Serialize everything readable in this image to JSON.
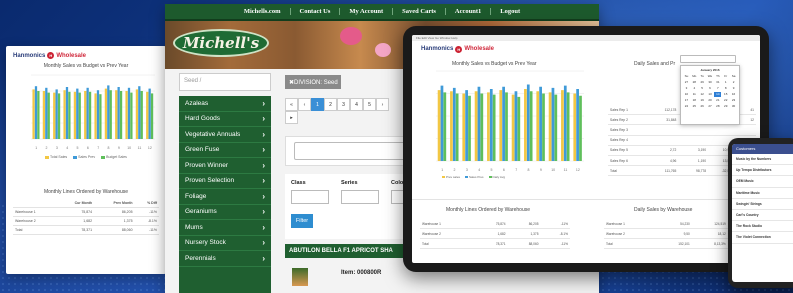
{
  "left_card": {
    "logo": {
      "name": "Hanmonics",
      "badge": "H",
      "suffix": "Wholesale"
    },
    "chart": {
      "title": "Monthly Sales vs Budget vs Prev Year"
    },
    "chart_data": {
      "type": "bar",
      "categories": [
        "1",
        "2",
        "3",
        "4",
        "5",
        "6",
        "7",
        "8",
        "9",
        "10",
        "11",
        "12"
      ],
      "series": [
        {
          "name": "Total Sales",
          "values": [
            62,
            60,
            58,
            61,
            59,
            60,
            57,
            63,
            61,
            60,
            62,
            59
          ],
          "color": "#f2c744"
        },
        {
          "name": "Sales Prev",
          "values": [
            66,
            64,
            62,
            65,
            63,
            64,
            61,
            67,
            65,
            64,
            66,
            63
          ],
          "color": "#3f9ad8"
        },
        {
          "name": "Budget Sales",
          "values": [
            60,
            58,
            57,
            59,
            58,
            59,
            56,
            61,
            60,
            58,
            60,
            57
          ],
          "color": "#5fbf5b"
        }
      ],
      "ylim": [
        0,
        80
      ]
    },
    "lines_title": "Monthly Lines Ordered by Warehouse",
    "lines_headers": [
      "",
      "Cur Month",
      "Prev Month",
      "% Diff"
    ],
    "lines_rows": [
      [
        "Warehouse 1",
        "75,874",
        "86,205",
        "-11%"
      ],
      [
        "Warehouse 2",
        "1,682",
        "1,375",
        "-8.1%"
      ],
      [
        "Total",
        "78,371",
        "88,060",
        "-11%"
      ]
    ]
  },
  "shop": {
    "nav": [
      "Michells.com",
      "Contact Us",
      "My Account",
      "Saved Carts",
      "Account1",
      "Logout"
    ],
    "brand": "Michell's",
    "search_placeholder": "Seed /",
    "division": "✖DIVISION: Seed",
    "sidebar": [
      "Azaleas",
      "Hard Goods",
      "Vegetative Annuals",
      "Green Fuse",
      "Proven Winner",
      "Proven Selection",
      "Foliage",
      "Geraniums",
      "Mums",
      "Nursery Stock",
      "Perennials"
    ],
    "pager": [
      "«",
      "‹",
      "1",
      "2",
      "3",
      "4",
      "5",
      "›",
      "▸"
    ],
    "filter_labels": [
      "Class",
      "Series",
      "Colo"
    ],
    "filter_button": "Filter",
    "product_title": "ABUTILON BELLA F1 APRICOT SHA",
    "item_label": "Item: 000800R"
  },
  "tablet": {
    "menu": "File  Edit  View  Go  Window  Help",
    "logo": {
      "name": "Hanmonics",
      "badge": "H",
      "suffix": "Wholesale"
    },
    "chart_title": "Monthly Sales vs Budget vs Prev Year",
    "chart_title_right": "Daily Sales and Pr",
    "chart_data": {
      "type": "bar",
      "categories": [
        "1",
        "2",
        "3",
        "4",
        "5",
        "6",
        "7",
        "8",
        "9",
        "10",
        "11",
        "12"
      ],
      "series": [
        {
          "name": "Prev sales",
          "values": [
            63,
            62,
            60,
            62,
            61,
            63,
            59,
            64,
            62,
            61,
            63,
            60
          ],
          "color": "#f2c744"
        },
        {
          "name": "Sales Pres",
          "values": [
            67,
            65,
            63,
            66,
            64,
            66,
            62,
            68,
            66,
            65,
            67,
            64
          ],
          "color": "#3f9ad8"
        },
        {
          "name": "Daily Avg",
          "values": [
            61,
            60,
            58,
            60,
            59,
            61,
            57,
            62,
            60,
            59,
            61,
            58
          ],
          "color": "#5fbf5b"
        }
      ],
      "ylim": [
        0,
        80
      ]
    },
    "calendar_title": "January 2016",
    "calendar_dow": [
      "Su",
      "Mo",
      "Tu",
      "We",
      "Th",
      "Fr",
      "Sa"
    ],
    "calendar_days": [
      "27",
      "28",
      "29",
      "30",
      "31",
      "1",
      "2",
      "3",
      "4",
      "5",
      "6",
      "7",
      "8",
      "9",
      "10",
      "11",
      "12",
      "13",
      "14",
      "15",
      "16",
      "17",
      "18",
      "19",
      "20",
      "21",
      "22",
      "23",
      "24",
      "25",
      "26",
      "27",
      "28",
      "29",
      "30"
    ],
    "calendar_selected": "14",
    "rep_rows": [
      [
        "Sales Rep 1",
        "112,178",
        "108,210",
        "93,4",
        "41"
      ],
      [
        "Sales Rep 2",
        "31,848",
        "22,320",
        "2,9",
        "12"
      ],
      [
        "Sales Rep 3",
        "",
        "",
        "",
        ""
      ],
      [
        "Sales Rep 4",
        "",
        "",
        "",
        ""
      ],
      [
        "Sales Rep 5",
        "2,72",
        "3,190",
        "10,90",
        "30"
      ],
      [
        "Sales Rep 6",
        "4,96",
        "1,190",
        "13,56",
        "2,3"
      ],
      [
        "Total",
        "111,765",
        "98,778",
        "-32,57",
        "82,90"
      ]
    ],
    "lines_title": "Monthly Lines Ordered by Warehouse",
    "lines_rows": [
      [
        "Warehouse 1",
        "75,874",
        "86,205",
        "-11%"
      ],
      [
        "Warehouse 2",
        "1,682",
        "1,375",
        "-8.1%"
      ],
      [
        "Total",
        "78,371",
        "88,060",
        "-11%"
      ]
    ],
    "daily_title": "Daily Sales by Warehouse",
    "daily_rows": [
      [
        "Warehouse 1",
        "54,230",
        "124,519",
        "-31%"
      ],
      [
        "Warehouse 2",
        "9,50",
        "18,12",
        "-34%"
      ],
      [
        "Total",
        "152,101",
        "8,13,3%",
        "-31%"
      ]
    ]
  },
  "phone": {
    "header": "Customers",
    "items": [
      "Music by the Numbers",
      "Up Tempo Distributors",
      "OEM Music",
      "Maritime Music",
      "Swingin' Strings",
      "Carl's Country",
      "The Rock Studio",
      "The Violet Connection"
    ]
  }
}
